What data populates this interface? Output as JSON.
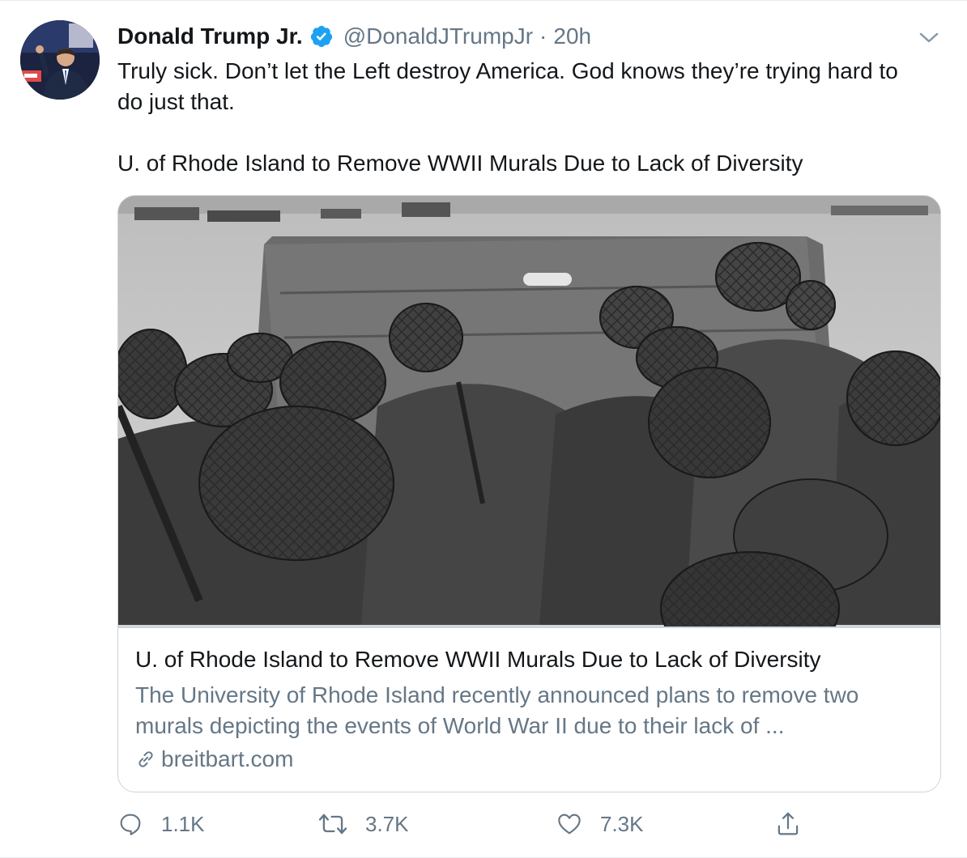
{
  "tweet": {
    "author_name": "Donald Trump Jr.",
    "handle": "@DonaldJTrumpJr",
    "separator": "·",
    "time": "20h",
    "text_line1": "Truly sick. Don’t let the Left destroy America. God knows they’re trying hard to do just that.",
    "text_line2": "U. of Rhode Island to Remove WWII Murals Due to Lack of Diversity"
  },
  "card": {
    "title": "U. of Rhode Island to Remove WWII Murals Due to Lack of Diversity",
    "description": "The University of Rhode Island recently announced plans to remove two murals depicting the events of World War II due to their lack of ...",
    "domain": "breitbart.com"
  },
  "actions": {
    "replies": "1.1K",
    "retweets": "3.7K",
    "likes": "7.3K"
  },
  "icons": {
    "verified": "verified-badge-icon",
    "chevron": "chevron-down-icon",
    "link": "link-icon",
    "reply": "reply-icon",
    "retweet": "retweet-icon",
    "like": "heart-icon",
    "share": "share-icon"
  },
  "colors": {
    "verified_blue": "#1da1f2",
    "secondary_text": "#657786",
    "primary_text": "#14171a",
    "border": "#ccd6dd"
  }
}
